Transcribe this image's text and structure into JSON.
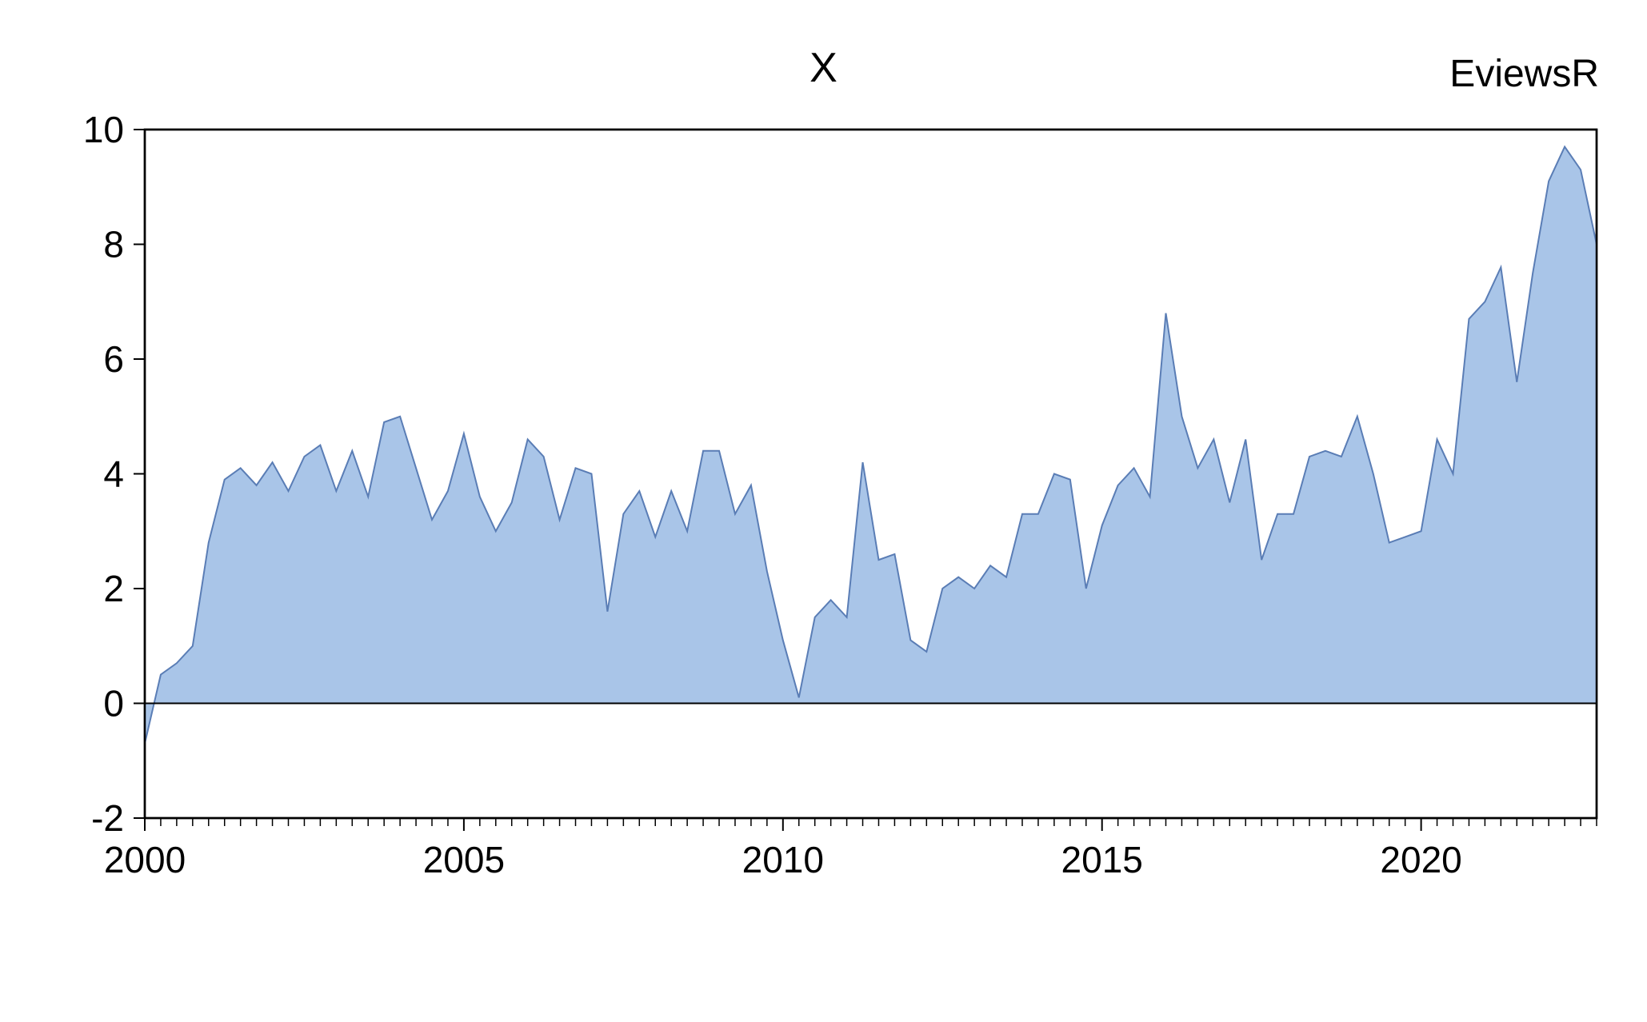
{
  "title": "X",
  "watermark": "EviewsR",
  "chart_data": {
    "type": "area",
    "title": "X",
    "xlabel": "",
    "ylabel": "",
    "xlim": [
      2000,
      2022.75
    ],
    "ylim": [
      -2,
      10
    ],
    "x_ticks": [
      2000,
      2005,
      2010,
      2015,
      2020
    ],
    "y_ticks": [
      -2,
      0,
      2,
      4,
      6,
      8,
      10
    ],
    "fill_color": "#a9c5e8",
    "line_color": "#5a7db5",
    "series": [
      {
        "name": "X",
        "x": [
          2000.0,
          2000.25,
          2000.5,
          2000.75,
          2001.0,
          2001.25,
          2001.5,
          2001.75,
          2002.0,
          2002.25,
          2002.5,
          2002.75,
          2003.0,
          2003.25,
          2003.5,
          2003.75,
          2004.0,
          2004.25,
          2004.5,
          2004.75,
          2005.0,
          2005.25,
          2005.5,
          2005.75,
          2006.0,
          2006.25,
          2006.5,
          2006.75,
          2007.0,
          2007.25,
          2007.5,
          2007.75,
          2008.0,
          2008.25,
          2008.5,
          2008.75,
          2009.0,
          2009.25,
          2009.5,
          2009.75,
          2010.0,
          2010.25,
          2010.5,
          2010.75,
          2011.0,
          2011.25,
          2011.5,
          2011.75,
          2012.0,
          2012.25,
          2012.5,
          2012.75,
          2013.0,
          2013.25,
          2013.5,
          2013.75,
          2014.0,
          2014.25,
          2014.5,
          2014.75,
          2015.0,
          2015.25,
          2015.5,
          2015.75,
          2016.0,
          2016.25,
          2016.5,
          2016.75,
          2017.0,
          2017.25,
          2017.5,
          2017.75,
          2018.0,
          2018.25,
          2018.5,
          2018.75,
          2019.0,
          2019.25,
          2019.5,
          2019.75,
          2020.0,
          2020.25,
          2020.5,
          2020.75,
          2021.0,
          2021.25,
          2021.5,
          2021.75,
          2022.0,
          2022.25,
          2022.5,
          2022.75
        ],
        "values": [
          -0.7,
          0.5,
          0.7,
          1.0,
          2.8,
          3.9,
          4.1,
          3.8,
          4.2,
          3.7,
          4.3,
          4.5,
          3.7,
          4.4,
          3.6,
          4.9,
          5.0,
          4.1,
          3.2,
          3.7,
          4.7,
          3.6,
          3.0,
          3.5,
          4.6,
          4.3,
          3.2,
          4.1,
          4.0,
          1.6,
          3.3,
          3.7,
          2.9,
          3.7,
          3.0,
          4.4,
          4.4,
          3.3,
          3.8,
          2.3,
          1.1,
          0.1,
          1.5,
          1.8,
          1.5,
          4.2,
          2.5,
          2.6,
          1.1,
          0.9,
          2.0,
          2.2,
          2.0,
          2.4,
          2.2,
          3.3,
          3.3,
          4.0,
          3.9,
          2.0,
          3.1,
          3.8,
          4.1,
          3.6,
          6.8,
          5.0,
          4.1,
          4.6,
          3.5,
          4.6,
          2.5,
          3.3,
          3.3,
          4.3,
          4.4,
          4.3,
          5.0,
          4.0,
          2.8,
          2.9,
          3.0,
          4.6,
          4.0,
          6.7,
          7.0,
          7.6,
          5.6,
          7.5,
          9.1,
          9.7,
          9.3,
          8.0
        ]
      }
    ]
  }
}
